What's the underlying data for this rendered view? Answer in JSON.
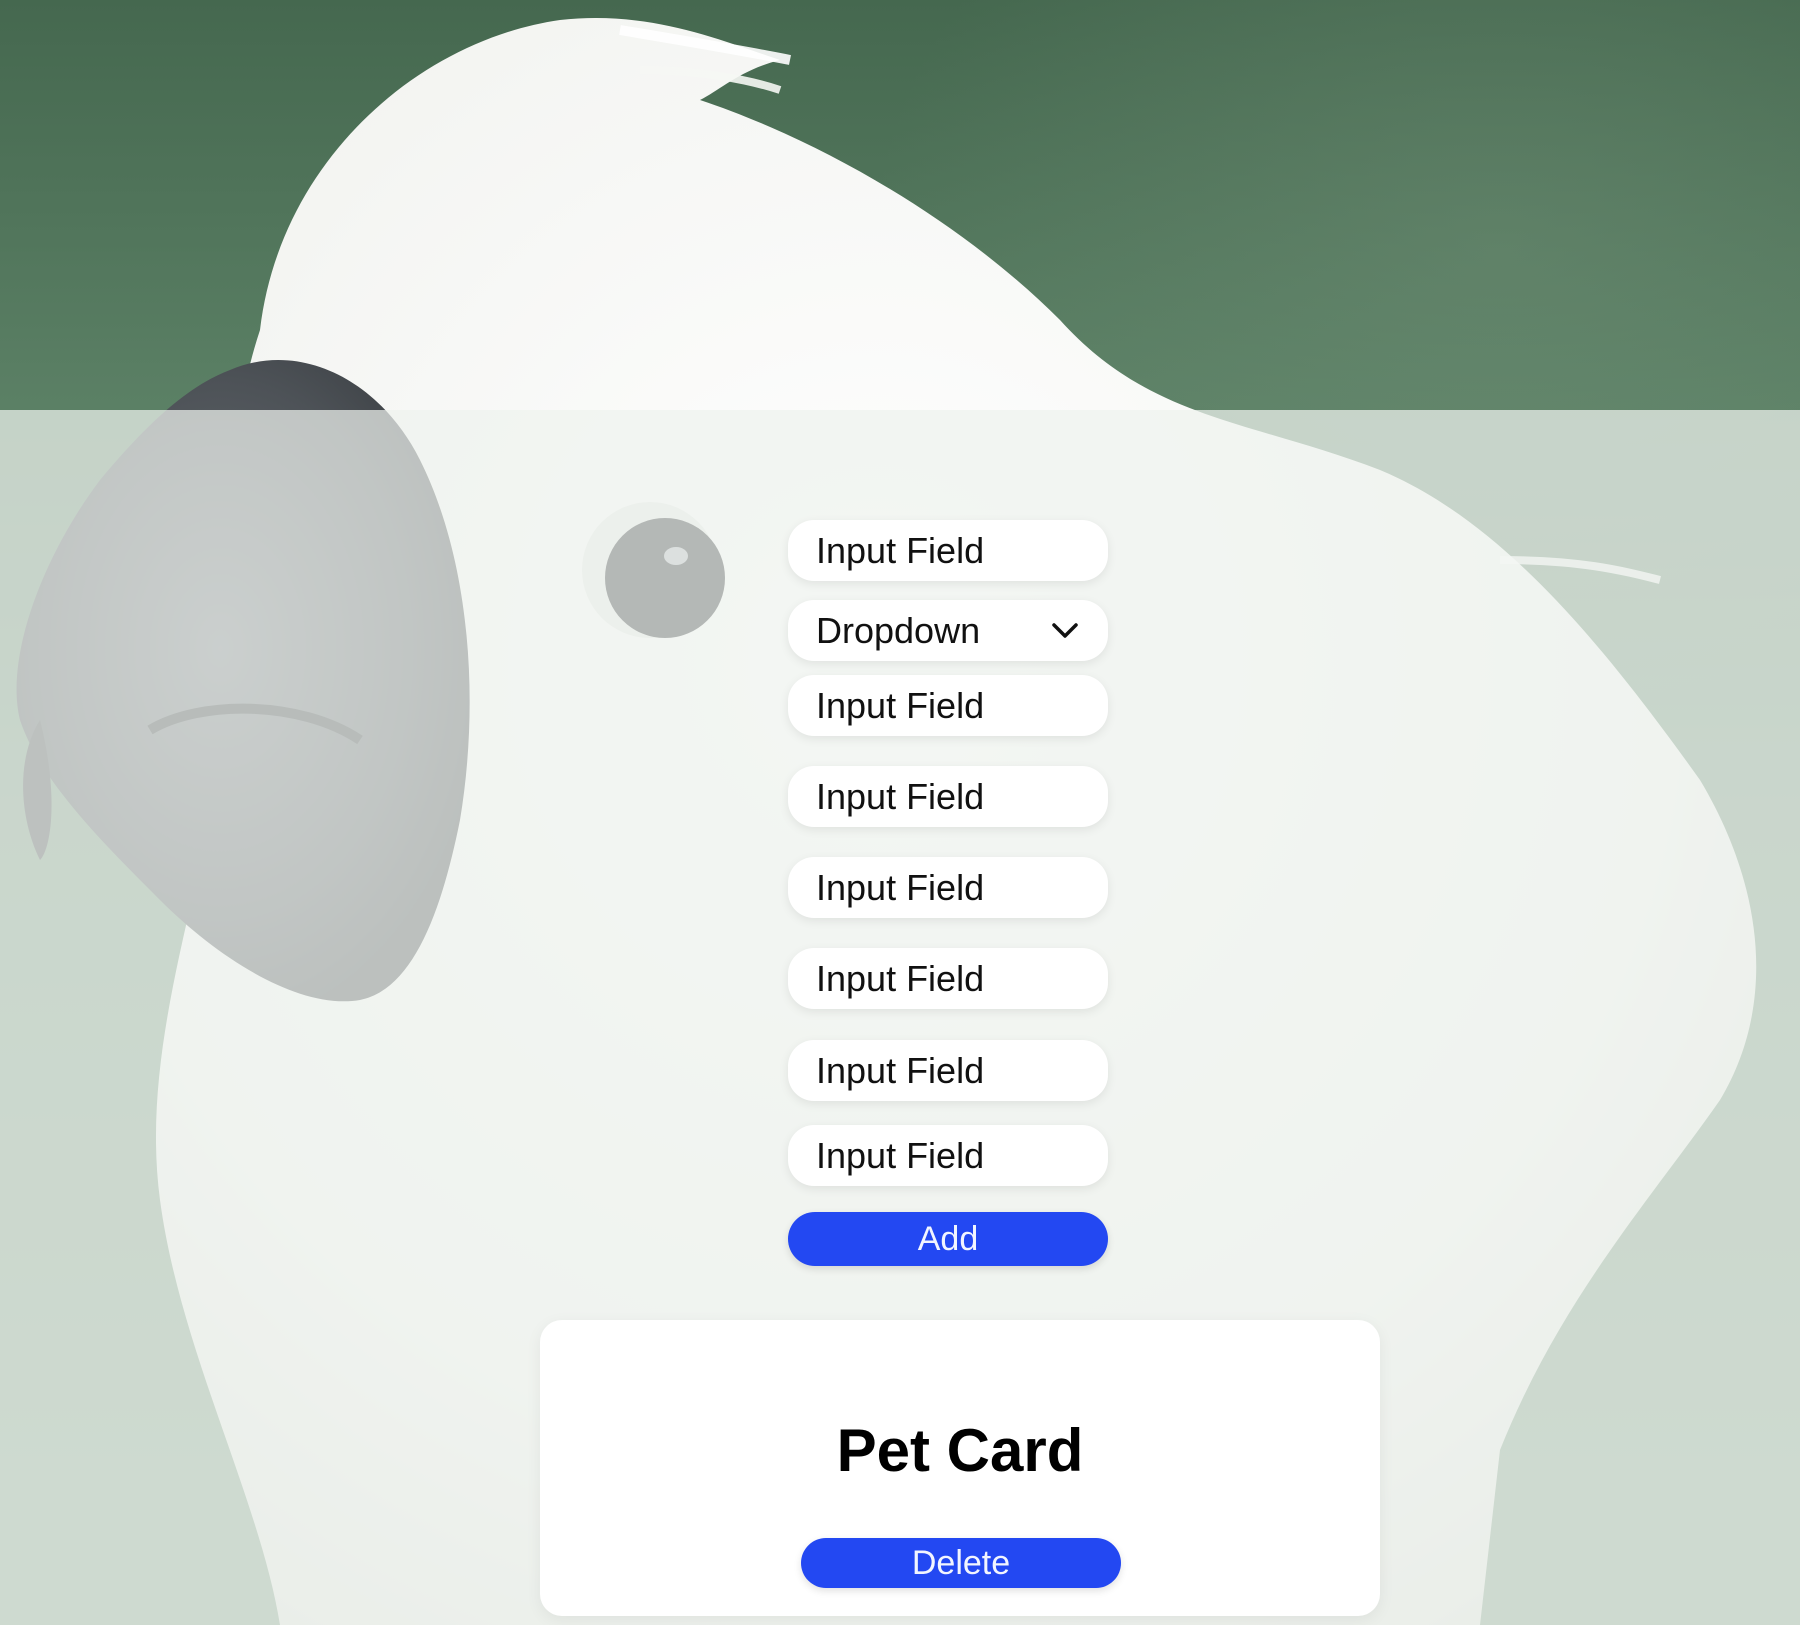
{
  "form": {
    "fields": [
      {
        "placeholder": "Input Field"
      },
      {
        "placeholder": "Input Field"
      },
      {
        "placeholder": "Input Field"
      },
      {
        "placeholder": "Input Field"
      },
      {
        "placeholder": "Input Field"
      },
      {
        "placeholder": "Input Field"
      },
      {
        "placeholder": "Input Field"
      }
    ],
    "dropdown": {
      "selected": "Dropdown",
      "icon": "chevron-down-icon"
    },
    "add_label": "Add"
  },
  "card": {
    "title": "Pet Card",
    "delete_label": "Delete"
  },
  "colors": {
    "accent": "#2348f2",
    "background": "#4d7359",
    "overlay": "#eef3ee",
    "card": "#ffffff"
  }
}
